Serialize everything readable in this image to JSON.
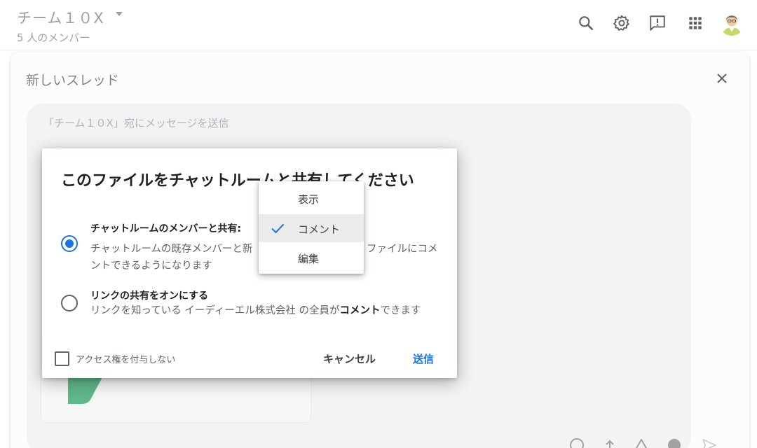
{
  "header": {
    "room_name": "チーム１０X",
    "member_count": "5 人のメンバー",
    "icons": [
      "search-icon",
      "gear-icon",
      "feedback-icon",
      "apps-grid-icon"
    ]
  },
  "thread": {
    "title": "新しいスレッド",
    "composer_placeholder": "「チーム１０X」宛にメッセージを送信"
  },
  "dialog": {
    "title": "このファイルをチャットルームと共有してください",
    "option_members": {
      "heading": "チャットルームのメンバーと共有:",
      "desc_line1_left": "チャットルームの既存メンバーと新",
      "desc_line1_right": "ファイルにコメ",
      "desc_line2": "ントできるようになります",
      "selected": true
    },
    "option_link": {
      "heading": "リンクの共有をオンにする",
      "desc_part1": "リンクを知っている イーディーエル株式会社 の全員が",
      "desc_bold": "コメント",
      "desc_part2": "できます",
      "selected": false
    },
    "no_access_label": "アクセス権を付与しない",
    "cancel_label": "キャンセル",
    "send_label": "送信"
  },
  "permission_menu": {
    "items": [
      {
        "label": "表示",
        "selected": false
      },
      {
        "label": "コメント",
        "selected": true
      },
      {
        "label": "編集",
        "selected": false
      }
    ]
  },
  "colors": {
    "accent": "#1a73e8",
    "drive_green": "#4caf7d"
  }
}
